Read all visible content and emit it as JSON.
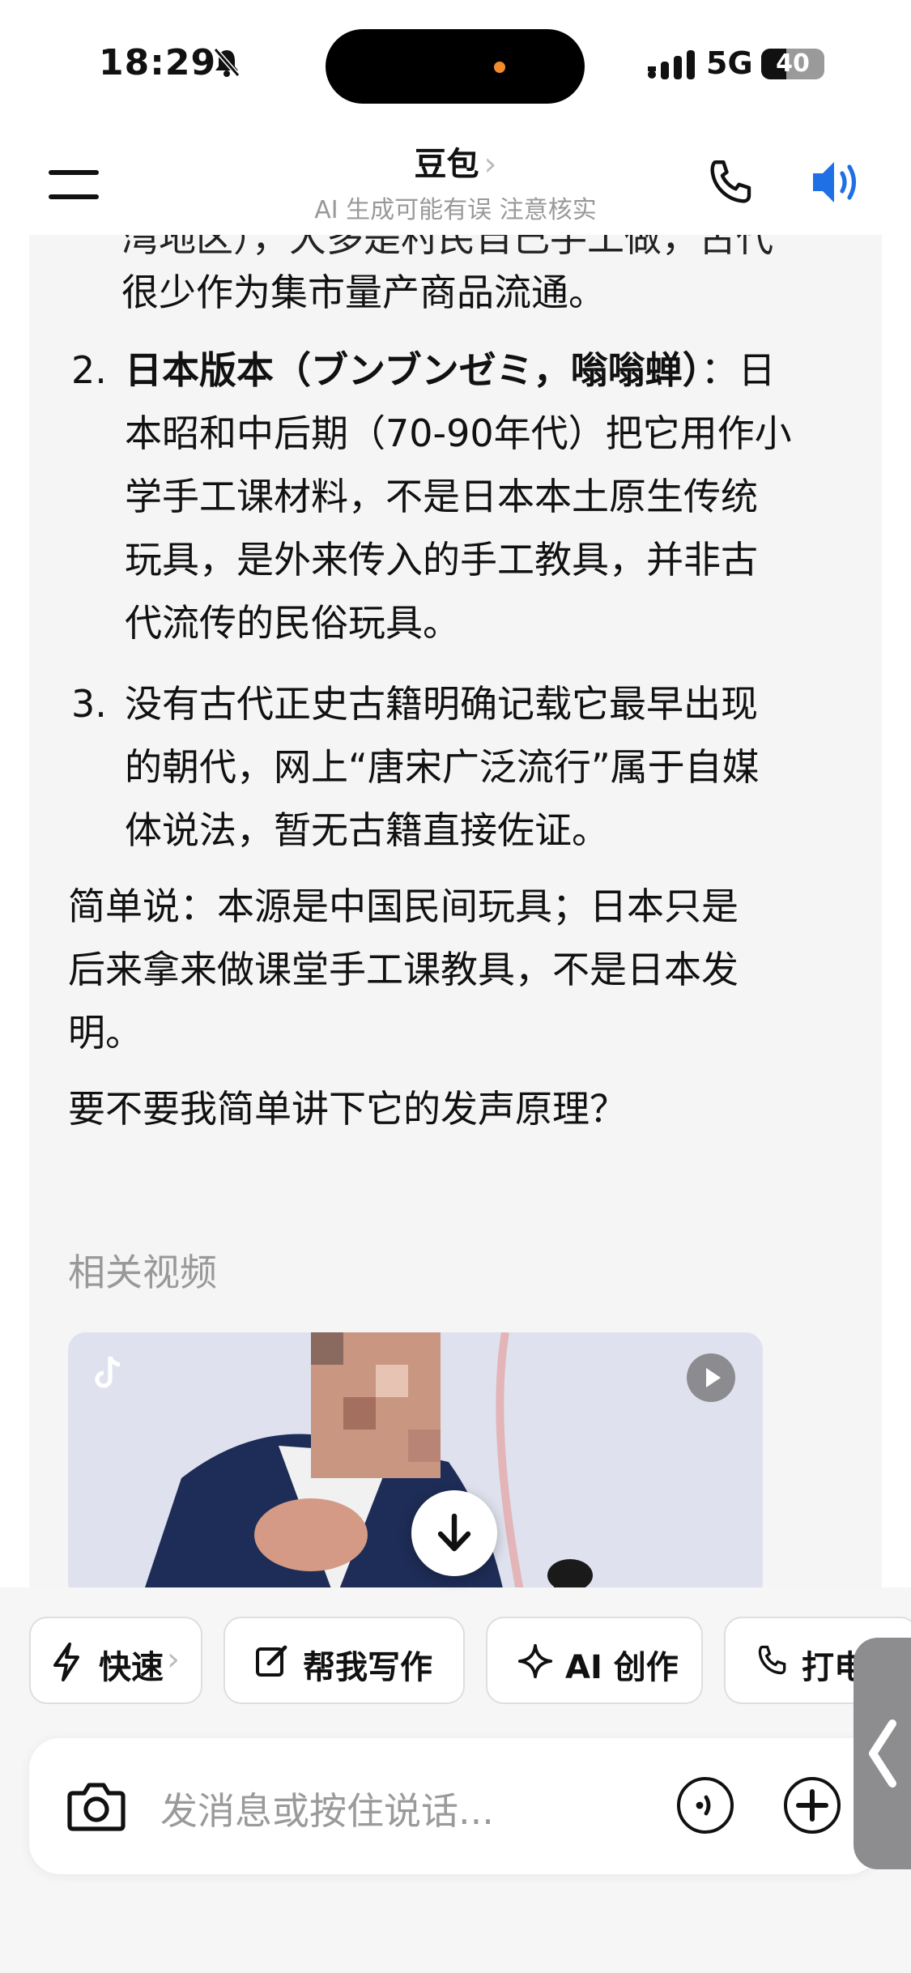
{
  "status_bar": {
    "time": "18:29",
    "network": "5G",
    "battery": "40",
    "battery_level": 0.4
  },
  "header": {
    "title": "豆包",
    "title_chevron": "›",
    "subtitle": "AI 生成可能有误 注意核实"
  },
  "message": {
    "cut_line": "湾地区），大多是村民自己手工做，古代",
    "intro_tail": "很少作为集市量产商品流通。",
    "items": [
      {
        "num": "2.",
        "bold": "日本版本（ブンブンゼミ，嗡嗡蝉）",
        "rest": "：日",
        "lines": [
          "本昭和中后期（70-90年代）把它用作小",
          "学手工课材料，不是日本本土原生传统",
          "玩具，是外来传入的手工教具，并非古",
          "代流传的民俗玩具。"
        ]
      },
      {
        "num": "3.",
        "lines": [
          "没有古代正史古籍明确记载它最早出现",
          "的朝代，网上“唐宋广泛流行”属于自媒",
          "体说法，暂无古籍直接佐证。"
        ]
      }
    ],
    "summary_lines": [
      "简单说：本源是中国民间玩具；日本只是",
      "后来拿来做课堂手工课教具，不是日本发",
      "明。"
    ],
    "question": "要不要我简单讲下它的发声原理？",
    "related_videos_heading": "相关视频"
  },
  "actions": {
    "chips": [
      {
        "icon": "lightning-icon",
        "label": "快速",
        "chevron": "›"
      },
      {
        "icon": "edit-icon",
        "label": "帮我写作"
      },
      {
        "icon": "sparkle-icon",
        "label": "AI 创作"
      },
      {
        "icon": "phone-icon",
        "label": "打电"
      }
    ]
  },
  "input": {
    "placeholder": "发消息或按住说话..."
  },
  "colors": {
    "accent": "#1f6fe5",
    "card_bg": "#f5f5f6",
    "muted": "#999999"
  }
}
